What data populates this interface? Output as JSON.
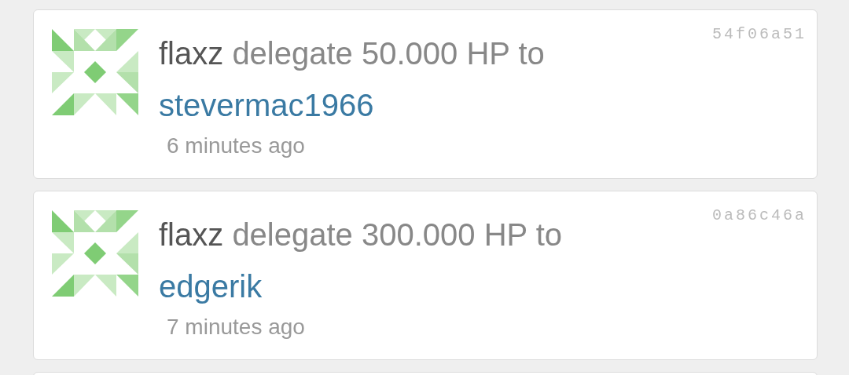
{
  "entries": [
    {
      "actor": "flaxz",
      "action": "delegate 50.000 HP to",
      "target": "stevermac1966",
      "time": "6 minutes ago",
      "hash": "54f06a51"
    },
    {
      "actor": "flaxz",
      "action": "delegate 300.000 HP to",
      "target": "edgerik",
      "time": "7 minutes ago",
      "hash": "0a86c46a"
    }
  ]
}
